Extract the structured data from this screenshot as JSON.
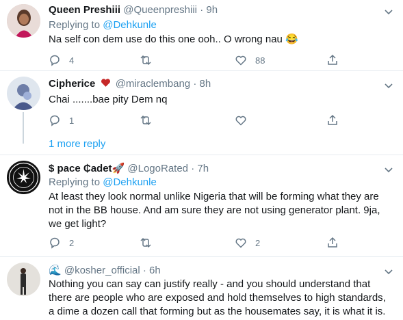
{
  "tweets": [
    {
      "name": "Queen Preshiii",
      "handle": "@Queenpreshiii",
      "time": "9h",
      "replying_prefix": "Replying to ",
      "replying_to": "@Dehkunle",
      "text": "Na self con dem use do this one ooh.. O wrong nau 😂",
      "replies": "4",
      "retweets": "",
      "likes": "88"
    },
    {
      "name": "Cipherice",
      "handle": "@miraclembang",
      "time": "8h",
      "text": "Chai .......bae pity Dem nq",
      "replies": "1",
      "retweets": "",
      "likes": ""
    },
    {
      "name": "$ pace ₵adet🚀",
      "handle": "@LogoRated",
      "time": "7h",
      "replying_prefix": "Replying to ",
      "replying_to": "@Dehkunle",
      "text": "At least they look normal unlike Nigeria that will be forming what they are not in the BB house. And am sure they are not using generator plant. 9ja, we get light?",
      "replies": "2",
      "retweets": "",
      "likes": "2"
    },
    {
      "name": "🌊 ",
      "handle": "@kosher_official",
      "time": "6h",
      "text": "Nothing you can say can justify really - and you should understand that there are people who are exposed and hold themselves to high standards, a dime a dozen call that forming but as the housemates say, it is what it is."
    }
  ],
  "more_replies": "1 more reply",
  "dot": "·",
  "colors": {
    "accent": "#1da1f2",
    "muted": "#657786",
    "heart": "#e0245e",
    "divider": "#e6ecf0"
  }
}
